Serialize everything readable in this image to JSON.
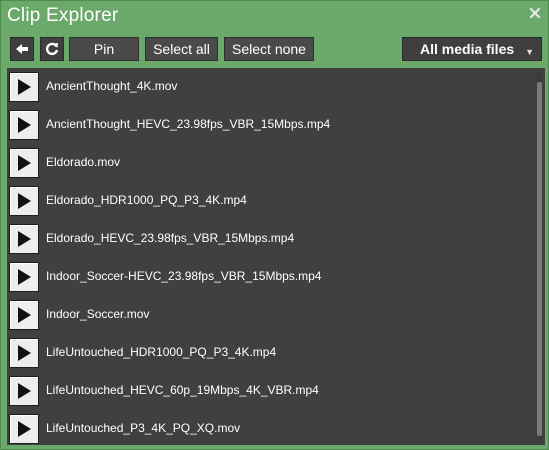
{
  "window": {
    "title": "Clip Explorer"
  },
  "toolbar": {
    "back_icon": "arrow-left-icon",
    "refresh_icon": "refresh-icon",
    "pin_label": "Pin",
    "select_all_label": "Select all",
    "select_none_label": "Select none",
    "filter_value": "All media files"
  },
  "files": [
    {
      "name": "AncientThought_4K.mov"
    },
    {
      "name": "AncientThought_HEVC_23.98fps_VBR_15Mbps.mp4"
    },
    {
      "name": "Eldorado.mov"
    },
    {
      "name": "Eldorado_HDR1000_PQ_P3_4K.mp4"
    },
    {
      "name": "Eldorado_HEVC_23.98fps_VBR_15Mbps.mp4"
    },
    {
      "name": "Indoor_Soccer-HEVC_23.98fps_VBR_15Mbps.mp4"
    },
    {
      "name": "Indoor_Soccer.mov"
    },
    {
      "name": "LifeUntouched_HDR1000_PQ_P3_4K.mp4"
    },
    {
      "name": "LifeUntouched_HEVC_60p_19Mbps_4K_VBR.mp4"
    },
    {
      "name": "LifeUntouched_P3_4K_PQ_XQ.mov"
    }
  ],
  "colors": {
    "accent": "#6aa969",
    "list_bg": "#404040",
    "button_bg": "#4a4a4a"
  }
}
